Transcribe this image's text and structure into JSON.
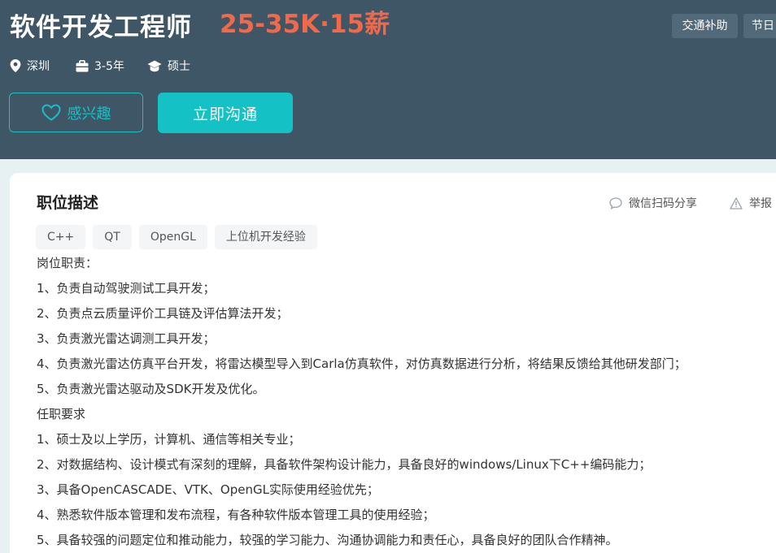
{
  "header": {
    "job_title": "软件开发工程师",
    "salary": "25-35K·15薪",
    "benefits": [
      "交通补助",
      "节日"
    ],
    "meta": {
      "city": "深圳",
      "experience": "3-5年",
      "degree": "硕士"
    },
    "like_label": "感兴趣",
    "chat_label": "立即沟通"
  },
  "card": {
    "section_title": "职位描述",
    "share_label": "微信扫码分享",
    "report_label": "举报",
    "tags": [
      "C++",
      "QT",
      "OpenGL",
      "上位机开发经验"
    ],
    "lines": [
      "岗位职责：",
      "1、负责自动驾驶测试工具开发；",
      "2、负责点云质量评价工具链及评估算法开发；",
      "3、负责激光雷达调测工具开发；",
      "4、负责激光雷达仿真平台开发，将雷达模型导入到Carla仿真软件，对仿真数据进行分析，将结果反馈给其他研发部门；",
      "5、负责激光雷达驱动及SDK开发及优化。",
      "任职要求",
      "1、硕士及以上学历，计算机、通信等相关专业；",
      "2、对数据结构、设计模式有深刻的理解，具备软件架构设计能力，具备良好的windows/Linux下C++编码能力；",
      "3、具备OpenCASCADE、VTK、OpenGL实际使用经验优先；",
      "4、熟悉软件版本管理和发布流程，有各种软件版本管理工具的使用经验；",
      "5、具备较强的问题定位和推动能力，较强的学习能力、沟通协调能力和责任心，具备良好的团队合作精神。"
    ]
  },
  "colors": {
    "header_bg": "#3f5667",
    "salary": "#f2694a",
    "accent": "#14c1c4"
  }
}
